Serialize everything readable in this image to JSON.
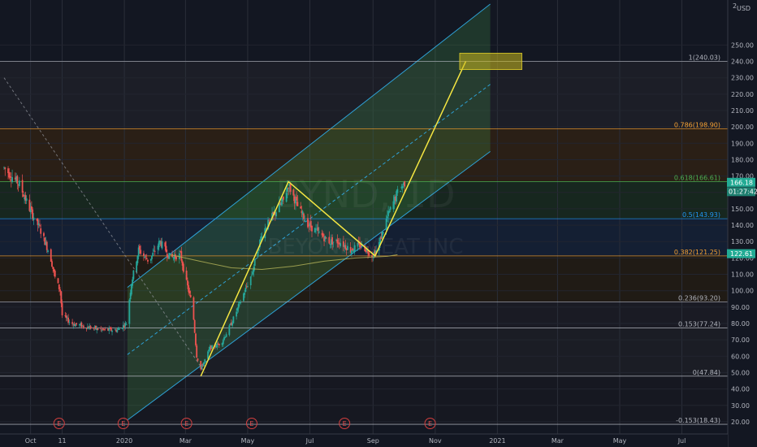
{
  "chart_data": {
    "type": "candlestick",
    "symbol_watermark": "BYND, 1D",
    "company_watermark": "BEYOND MEAT INC",
    "currency": "USD",
    "price_scale_top": "2",
    "ylim": [
      15,
      275
    ],
    "y_ticks": [
      20,
      30,
      40,
      50,
      60,
      70,
      80,
      90,
      100,
      110,
      120,
      130,
      140,
      150,
      160,
      170,
      180,
      190,
      200,
      210,
      220,
      230,
      240,
      250
    ],
    "x_ticks": [
      {
        "label": "Oct",
        "date": "2019-10-01"
      },
      {
        "label": "11",
        "date": "2019-11-01"
      },
      {
        "label": "2020",
        "date": "2020-01-01"
      },
      {
        "label": "Mar",
        "date": "2020-03-01"
      },
      {
        "label": "May",
        "date": "2020-05-01"
      },
      {
        "label": "Jul",
        "date": "2020-07-01"
      },
      {
        "label": "Sep",
        "date": "2020-09-01"
      },
      {
        "label": "Nov",
        "date": "2020-11-01"
      },
      {
        "label": "2021",
        "date": "2021-01-01"
      },
      {
        "label": "Mar",
        "date": "2021-03-01"
      },
      {
        "label": "May",
        "date": "2021-05-01"
      },
      {
        "label": "Jul",
        "date": "2021-07-01"
      }
    ],
    "last_price": "166.18",
    "countdown": "01:27:42",
    "marker_price": "122.61",
    "fib_levels": [
      {
        "ratio": "1",
        "label": "1(240.03)",
        "value": 240.03,
        "color": "#b2b5be"
      },
      {
        "ratio": "0.786",
        "label": "0.786(198.90)",
        "value": 198.9,
        "color": "#f7a233"
      },
      {
        "ratio": "0.618",
        "label": "0.618(166.61)",
        "value": 166.61,
        "color": "#4caf50"
      },
      {
        "ratio": "0.5",
        "label": "0.5(143.93)",
        "value": 143.93,
        "color": "#2196f3"
      },
      {
        "ratio": "0.382",
        "label": "0.382(121.25)",
        "value": 121.25,
        "color": "#f7a233"
      },
      {
        "ratio": "0.236",
        "label": "0.236(93.20)",
        "value": 93.2,
        "color": "#b2b5be"
      },
      {
        "ratio": "0.153",
        "label": "0.153(77.24)",
        "value": 77.24,
        "color": "#b2b5be"
      },
      {
        "ratio": "0",
        "label": "0(47.84)",
        "value": 47.84,
        "color": "#b2b5be"
      },
      {
        "ratio": "-0.153",
        "label": "-0.153(18.43)",
        "value": 18.43,
        "color": "#b2b5be"
      }
    ],
    "earnings_markers": [
      {
        "label": "E",
        "date": "2019-10-29"
      },
      {
        "label": "E",
        "date": "2019-12-31"
      },
      {
        "label": "E",
        "date": "2020-03-02"
      },
      {
        "label": "E",
        "date": "2020-05-05"
      },
      {
        "label": "E",
        "date": "2020-08-04"
      },
      {
        "label": "E",
        "date": "2020-10-27"
      }
    ],
    "price_series": [
      [
        "2019-09-05",
        175
      ],
      [
        "2019-09-20",
        165
      ],
      [
        "2019-09-30",
        150
      ],
      [
        "2019-10-10",
        138
      ],
      [
        "2019-10-20",
        122
      ],
      [
        "2019-10-25",
        108
      ],
      [
        "2019-10-30",
        100
      ],
      [
        "2019-11-01",
        85
      ],
      [
        "2019-11-10",
        80
      ],
      [
        "2019-11-25",
        78
      ],
      [
        "2019-12-10",
        76
      ],
      [
        "2019-12-25",
        76
      ],
      [
        "2020-01-03",
        80
      ],
      [
        "2020-01-08",
        105
      ],
      [
        "2020-01-15",
        125
      ],
      [
        "2020-01-25",
        118
      ],
      [
        "2020-02-05",
        130
      ],
      [
        "2020-02-15",
        120
      ],
      [
        "2020-02-25",
        122
      ],
      [
        "2020-03-02",
        105
      ],
      [
        "2020-03-08",
        90
      ],
      [
        "2020-03-12",
        60
      ],
      [
        "2020-03-16",
        52
      ],
      [
        "2020-03-25",
        65
      ],
      [
        "2020-04-05",
        68
      ],
      [
        "2020-04-15",
        80
      ],
      [
        "2020-04-25",
        95
      ],
      [
        "2020-05-05",
        110
      ],
      [
        "2020-05-15",
        135
      ],
      [
        "2020-05-25",
        145
      ],
      [
        "2020-06-05",
        155
      ],
      [
        "2020-06-10",
        165
      ],
      [
        "2020-06-20",
        150
      ],
      [
        "2020-06-30",
        140
      ],
      [
        "2020-07-10",
        135
      ],
      [
        "2020-07-20",
        130
      ],
      [
        "2020-07-30",
        130
      ],
      [
        "2020-08-10",
        125
      ],
      [
        "2020-08-20",
        128
      ],
      [
        "2020-08-31",
        122
      ],
      [
        "2020-09-05",
        125
      ],
      [
        "2020-09-15",
        145
      ],
      [
        "2020-09-25",
        160
      ],
      [
        "2020-10-02",
        166
      ]
    ],
    "moving_average": [
      [
        "2020-02-15",
        122
      ],
      [
        "2020-03-15",
        118
      ],
      [
        "2020-04-15",
        114
      ],
      [
        "2020-05-15",
        113
      ],
      [
        "2020-06-15",
        115
      ],
      [
        "2020-07-15",
        118
      ],
      [
        "2020-08-15",
        120
      ],
      [
        "2020-09-15",
        121
      ],
      [
        "2020-09-25",
        122
      ]
    ],
    "channel": {
      "lower": [
        [
          "2020-01-04",
          21
        ],
        [
          "2020-12-25",
          185
        ]
      ],
      "upper": [
        [
          "2020-01-04",
          102
        ],
        [
          "2020-12-25",
          275
        ]
      ],
      "median": [
        [
          "2020-01-04",
          61
        ],
        [
          "2020-12-25",
          226
        ]
      ]
    },
    "projection_path": [
      [
        "2020-03-16",
        47.84
      ],
      [
        "2020-06-10",
        166.61
      ],
      [
        "2020-09-03",
        121.25
      ],
      [
        "2020-12-01",
        240.03
      ]
    ],
    "target_zone": {
      "x0": "2020-11-25",
      "x1": "2021-01-25",
      "y0": 235,
      "y1": 245
    },
    "trend_line": [
      [
        "2019-09-05",
        230
      ],
      [
        "2020-03-20",
        50
      ]
    ]
  }
}
